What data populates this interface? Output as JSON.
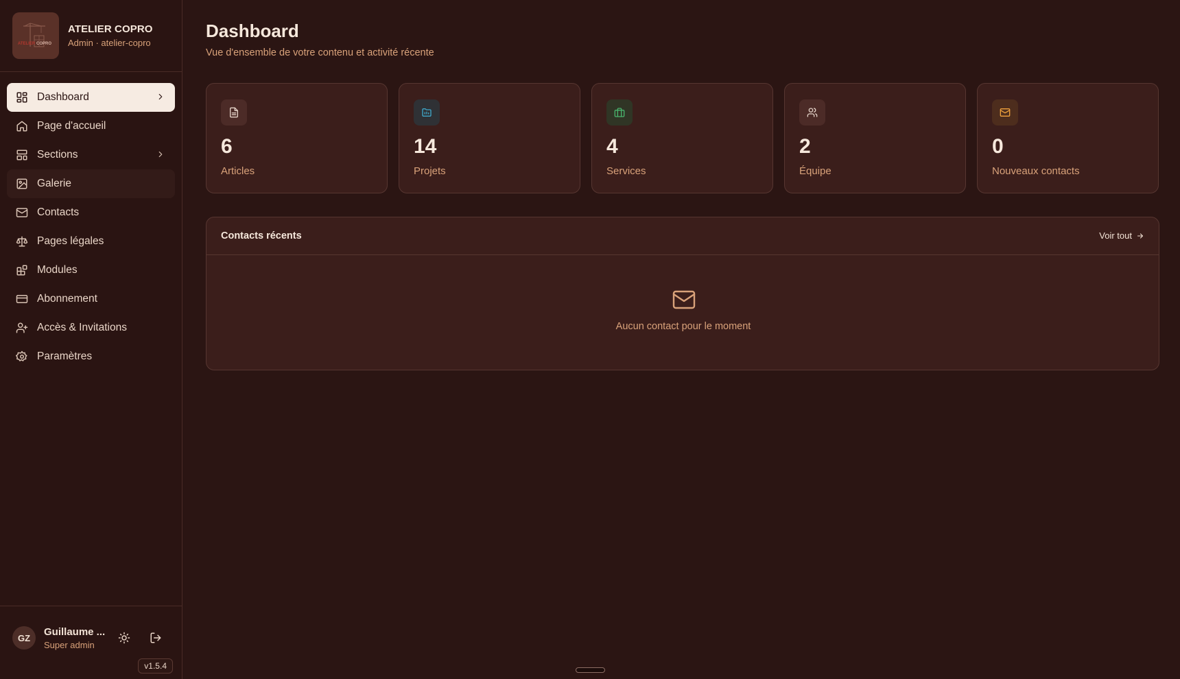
{
  "brand": {
    "name": "ATELIER COPRO",
    "subtitle": "Admin · atelier-copro",
    "logo_text_left": "ATELIER",
    "logo_text_right": "COPRO"
  },
  "nav": [
    {
      "label": "Dashboard",
      "icon": "grid-icon",
      "active": true,
      "chevron": true
    },
    {
      "label": "Page d'accueil",
      "icon": "home-icon"
    },
    {
      "label": "Sections",
      "icon": "layout-icon",
      "chevron": true
    },
    {
      "label": "Galerie",
      "icon": "image-icon",
      "hover": true
    },
    {
      "label": "Contacts",
      "icon": "mail-icon"
    },
    {
      "label": "Pages légales",
      "icon": "scale-icon"
    },
    {
      "label": "Modules",
      "icon": "blocks-icon"
    },
    {
      "label": "Abonnement",
      "icon": "credit-card-icon"
    },
    {
      "label": "Accès & Invitations",
      "icon": "user-plus-icon"
    },
    {
      "label": "Paramètres",
      "icon": "gear-icon"
    }
  ],
  "user": {
    "initials": "GZ",
    "name": "Guillaume ...",
    "role": "Super admin",
    "version": "v1.5.4"
  },
  "page": {
    "title": "Dashboard",
    "subtitle": "Vue d'ensemble de votre contenu et activité récente"
  },
  "stats": [
    {
      "value": "6",
      "label": "Articles",
      "icon": "file-text-icon",
      "color": "#e4d3c8",
      "bg": "#4c2b27"
    },
    {
      "value": "14",
      "label": "Projets",
      "icon": "folder-icon",
      "color": "#3fa7c9",
      "bg": "#2f3135"
    },
    {
      "value": "4",
      "label": "Services",
      "icon": "briefcase-icon",
      "color": "#49b36c",
      "bg": "#303525"
    },
    {
      "value": "2",
      "label": "Équipe",
      "icon": "users-icon",
      "color": "#e4d3c8",
      "bg": "#4c2b27"
    },
    {
      "value": "0",
      "label": "Nouveaux contacts",
      "icon": "mail-icon",
      "color": "#f0a23d",
      "bg": "#4d2d1d"
    }
  ],
  "recent": {
    "title": "Contacts récents",
    "link": "Voir tout",
    "empty": "Aucun contact pour le moment"
  },
  "colors": {
    "background": "#2b1513",
    "card": "#3b1e1b",
    "accent": "#d9a27a",
    "active": "#f6ebe2"
  }
}
